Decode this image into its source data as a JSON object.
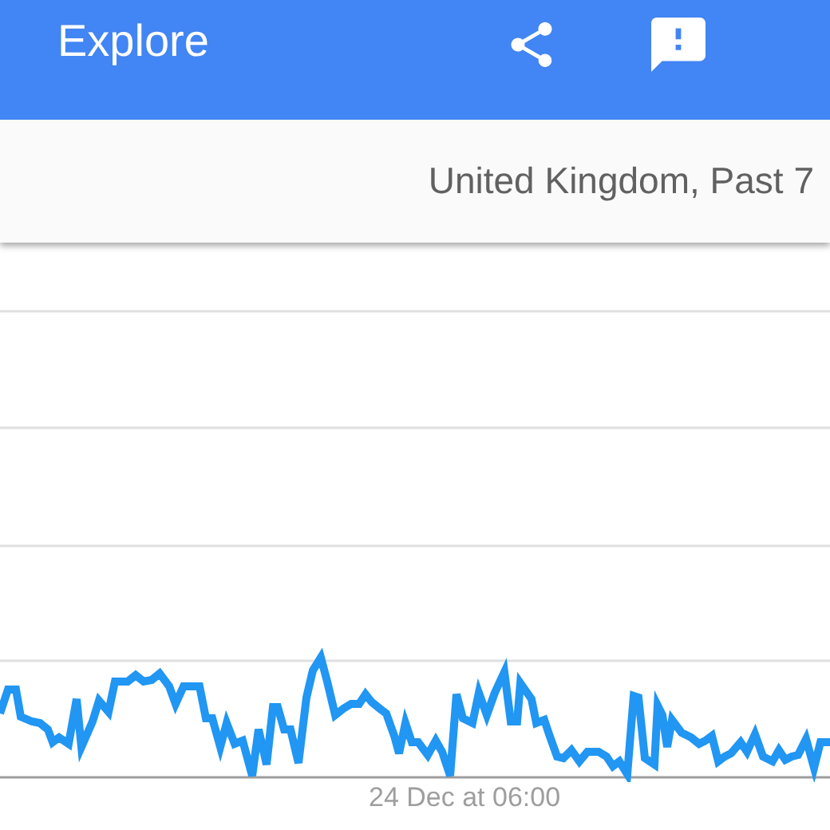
{
  "header": {
    "title": "Explore"
  },
  "filter_bar": {
    "text": "United Kingdom, Past 7"
  },
  "chart": {
    "x_label": "24 Dec at 06:00"
  }
}
